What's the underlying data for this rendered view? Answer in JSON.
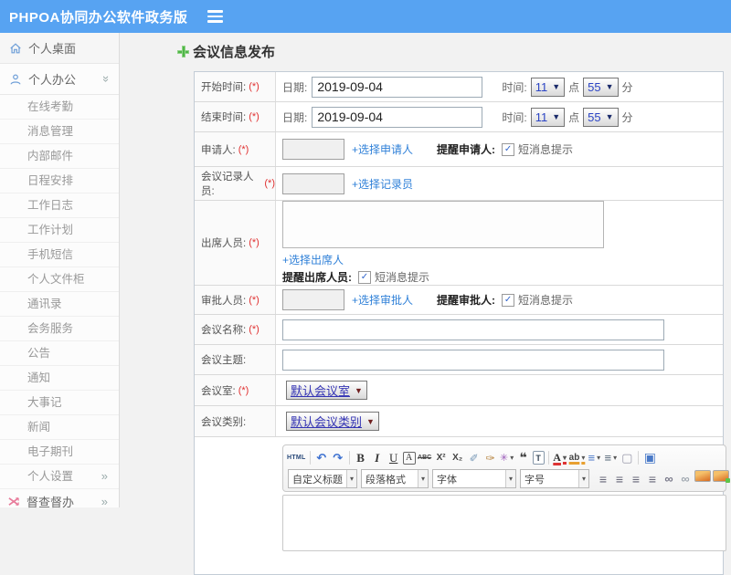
{
  "header": {
    "title": "PHPOA协同办公软件政务版"
  },
  "icons": {
    "select_arrow": "▼",
    "dropdown_arrow": "▾",
    "chevron": "»",
    "checkbox_check": "✓"
  },
  "colors": {
    "header_blue": "#57a3f2",
    "link_blue": "#2f80d8",
    "accent_green": "#4eb648",
    "required_red": "#e03030",
    "select_text_blue": "#2b44c4"
  },
  "sidebar": {
    "desktop": {
      "label": "个人桌面"
    },
    "office": {
      "label": "个人办公",
      "chev": "»"
    },
    "sub_items": [
      {
        "name": "sidebar-item-online-attendance",
        "label": "在线考勤"
      },
      {
        "name": "sidebar-item-message-management",
        "label": "消息管理"
      },
      {
        "name": "sidebar-item-internal-mail",
        "label": "内部邮件"
      },
      {
        "name": "sidebar-item-schedule",
        "label": "日程安排"
      },
      {
        "name": "sidebar-item-work-log",
        "label": "工作日志"
      },
      {
        "name": "sidebar-item-work-plan",
        "label": "工作计划"
      },
      {
        "name": "sidebar-item-mobile-sms",
        "label": "手机短信"
      },
      {
        "name": "sidebar-item-personal-cabinet",
        "label": "个人文件柜"
      },
      {
        "name": "sidebar-item-contacts",
        "label": "通讯录"
      },
      {
        "name": "sidebar-item-meeting-service",
        "label": "会务服务"
      },
      {
        "name": "sidebar-item-announcement",
        "label": "公告"
      },
      {
        "name": "sidebar-item-notice",
        "label": "通知"
      },
      {
        "name": "sidebar-item-major-events",
        "label": "大事记"
      },
      {
        "name": "sidebar-item-news",
        "label": "新闻"
      },
      {
        "name": "sidebar-item-e-journal",
        "label": "电子期刊"
      },
      {
        "name": "sidebar-item-personal-settings",
        "label": "个人设置",
        "chev": "»"
      }
    ],
    "supervise": {
      "label": "督查督办",
      "chev": "»"
    }
  },
  "form": {
    "title": "会议信息发布",
    "rows": {
      "start_time": {
        "label": "开始时间:",
        "required": "(*)",
        "date_label": "日期:",
        "date_value": "2019-09-04",
        "time_label": "时间:",
        "hour": "11",
        "hour_suffix": "点",
        "minute": "55",
        "minute_suffix": "分"
      },
      "end_time": {
        "label": "结束时间:",
        "required": "(*)",
        "date_label": "日期:",
        "date_value": "2019-09-04",
        "time_label": "时间:",
        "hour": "11",
        "hour_suffix": "点",
        "minute": "55",
        "minute_suffix": "分"
      },
      "applicant": {
        "label": "申请人:",
        "required": "(*)",
        "select_link": "+选择申请人",
        "remind_label": "提醒申请人:",
        "sms_label": "短消息提示"
      },
      "recorder": {
        "label": "会议记录人员:",
        "required": "(*)",
        "select_link": "+选择记录员"
      },
      "attendees": {
        "label": "出席人员:",
        "required": "(*)",
        "select_link": "+选择出席人",
        "remind_label": "提醒出席人员:",
        "sms_label": "短消息提示"
      },
      "approver": {
        "label": "审批人员:",
        "required": "(*)",
        "select_link": "+选择审批人",
        "remind_label": "提醒审批人:",
        "sms_label": "短消息提示"
      },
      "meeting_name": {
        "label": "会议名称:",
        "required": "(*)"
      },
      "meeting_topic": {
        "label": "会议主题:"
      },
      "meeting_room": {
        "label": "会议室:",
        "required": "(*)",
        "value": "默认会议室"
      },
      "meeting_category": {
        "label": "会议类别:",
        "value": "默认会议类别"
      }
    }
  },
  "editor": {
    "toolbar_row1": [
      {
        "name": "html-source-icon",
        "glyph": "HTML",
        "cls": "tb-html"
      },
      {
        "name": "toolbar-separator",
        "cls": "tb-sep",
        "inter": false
      },
      {
        "name": "undo-icon",
        "glyph": "↶",
        "cls": "tb-blue"
      },
      {
        "name": "redo-icon",
        "glyph": "↷",
        "cls": "tb-blue"
      },
      {
        "name": "toolbar-separator",
        "cls": "tb-sep",
        "inter": false
      },
      {
        "name": "bold-icon",
        "glyph": "B",
        "cls": "tb-b"
      },
      {
        "name": "italic-icon",
        "glyph": "I",
        "cls": "tb-i"
      },
      {
        "name": "underline-icon",
        "glyph": "U",
        "cls": "tb-u"
      },
      {
        "name": "font-border-icon",
        "glyph": "A",
        "cls": "tb-boxa"
      },
      {
        "name": "strikethrough-icon",
        "glyph": "ABC",
        "cls": "tb-strike"
      },
      {
        "name": "superscript-icon",
        "glyph": "X²",
        "cls": "tb-sup"
      },
      {
        "name": "subscript-icon",
        "glyph": "X₂",
        "cls": "tb-sup"
      },
      {
        "name": "eraser-icon",
        "glyph": "✐",
        "cls": "tb-eraser"
      },
      {
        "name": "format-brush-icon",
        "glyph": "✑",
        "cls": "tb-brush"
      },
      {
        "name": "autotypeset-icon",
        "glyph": "✳",
        "cls": "tb-wand tb-drop"
      },
      {
        "name": "blockquote-icon",
        "glyph": "❝",
        "cls": "tb-quote"
      },
      {
        "name": "paste-text-icon",
        "glyph": "T",
        "cls": "tb-paste"
      },
      {
        "name": "toolbar-separator",
        "cls": "tb-sep",
        "inter": false
      },
      {
        "name": "font-color-icon",
        "glyph": "A",
        "cls": "tb-fore tb-drop"
      },
      {
        "name": "highlight-color-icon",
        "glyph": "ab",
        "cls": "tb-hilite tb-drop"
      },
      {
        "name": "ordered-list-icon",
        "glyph": "≡",
        "cls": "tb-list tb-drop"
      },
      {
        "name": "unordered-list-icon",
        "glyph": "≡",
        "cls": "tb-list2 tb-drop"
      },
      {
        "name": "new-page-icon",
        "glyph": "▢",
        "cls": "tb-page"
      },
      {
        "name": "toolbar-separator",
        "cls": "tb-sep",
        "inter": false
      },
      {
        "name": "fullscreen-icon",
        "glyph": "▣",
        "cls": "tb-screen"
      }
    ],
    "toolbar_dropdowns": [
      {
        "name": "custom-title-select",
        "label": "自定义标题",
        "cls": "c1"
      },
      {
        "name": "paragraph-format-select",
        "label": "段落格式",
        "cls": "c2"
      },
      {
        "name": "font-family-select",
        "label": "字体",
        "cls": "c3"
      },
      {
        "name": "font-size-select",
        "label": "字号",
        "cls": "c4"
      }
    ],
    "toolbar_row2_icons": [
      {
        "name": "align-left-icon",
        "glyph": "≡",
        "cls": "tb-align"
      },
      {
        "name": "align-center-icon",
        "glyph": "≡",
        "cls": "tb-align"
      },
      {
        "name": "align-right-icon",
        "glyph": "≡",
        "cls": "tb-align"
      },
      {
        "name": "align-justify-icon",
        "glyph": "≡",
        "cls": "tb-align"
      },
      {
        "name": "insert-link-icon",
        "glyph": "∞",
        "cls": "tb-chain"
      },
      {
        "name": "remove-link-icon",
        "glyph": "∞",
        "cls": "tb-unchain"
      },
      {
        "name": "insert-image-icon",
        "cls": "tb-img"
      },
      {
        "name": "upload-image-icon",
        "cls": "tb-img tb-img2"
      },
      {
        "name": "insert-media-icon",
        "cls": "tb-media"
      },
      {
        "name": "insert-table-icon",
        "glyph": "▦",
        "cls": "tb-table"
      }
    ]
  }
}
